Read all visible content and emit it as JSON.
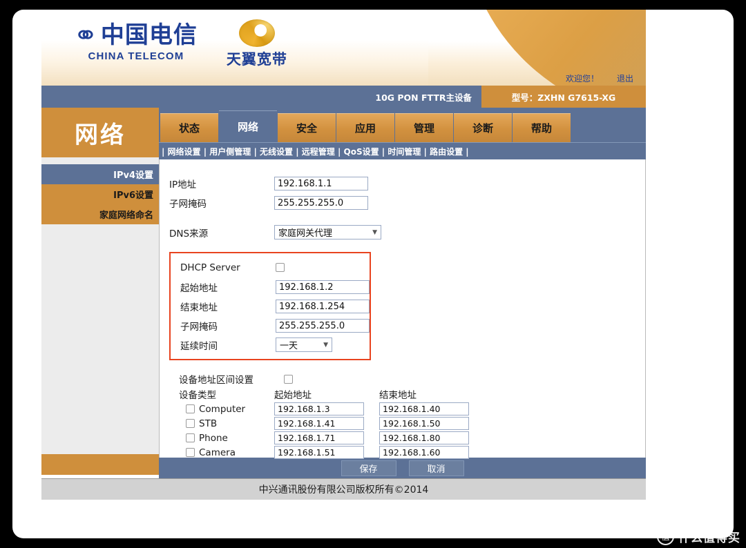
{
  "brand": {
    "telecom_cn": "中国电信",
    "telecom_en": "CHINA TELECOM",
    "broadband_cn": "天翼宽带"
  },
  "header": {
    "welcome": "欢迎您！",
    "logout": "退出",
    "device_type": "10G PON FTTR主设备",
    "model": "型号：ZXHN G7615-XG"
  },
  "sidebar": {
    "title": "网络",
    "items": [
      {
        "label": "IPv4设置",
        "active": true
      },
      {
        "label": "IPv6设置",
        "active": false
      },
      {
        "label": "家庭网络命名",
        "active": false
      }
    ]
  },
  "tabs": [
    {
      "label": "状态",
      "active": false
    },
    {
      "label": "网络",
      "active": true
    },
    {
      "label": "安全",
      "active": false
    },
    {
      "label": "应用",
      "active": false
    },
    {
      "label": "管理",
      "active": false
    },
    {
      "label": "诊断",
      "active": false
    },
    {
      "label": "帮助",
      "active": false
    }
  ],
  "subnav": "| 网络设置 | 用户侧管理 | 无线设置 | 远程管理 | QoS设置 | 时间管理 | 路由设置 |",
  "form": {
    "ip_label": "IP地址",
    "ip_value": "192.168.1.1",
    "mask_label": "子网掩码",
    "mask_value": "255.255.255.0",
    "dns_label": "DNS来源",
    "dns_value": "家庭网关代理"
  },
  "dhcp": {
    "title": "DHCP Server",
    "enabled": false,
    "start_label": "起始地址",
    "start_value": "192.168.1.2",
    "end_label": "结束地址",
    "end_value": "192.168.1.254",
    "mask_label": "子网掩码",
    "mask_value": "255.255.255.0",
    "lease_label": "延续时间",
    "lease_value": "一天",
    "highlight_color": "#e8431f"
  },
  "device_range": {
    "section_label": "设备地址区间设置",
    "enabled": false,
    "col_type": "设备类型",
    "col_start": "起始地址",
    "col_end": "结束地址",
    "rows": [
      {
        "name": "Computer",
        "checked": false,
        "start": "192.168.1.3",
        "end": "192.168.1.40"
      },
      {
        "name": "STB",
        "checked": false,
        "start": "192.168.1.41",
        "end": "192.168.1.50"
      },
      {
        "name": "Phone",
        "checked": false,
        "start": "192.168.1.71",
        "end": "192.168.1.80"
      },
      {
        "name": "Camera",
        "checked": false,
        "start": "192.168.1.51",
        "end": "192.168.1.60"
      }
    ]
  },
  "actions": {
    "save": "保存",
    "cancel": "取消"
  },
  "footer": {
    "copyright": "中兴通讯股份有限公司版权所有©2014"
  },
  "watermark": {
    "mark": "值",
    "text": "什么值得买"
  },
  "colors": {
    "orange": "#cf8f3c",
    "blue": "#5c7196",
    "accent_red": "#e8431f",
    "brand_blue": "#1f3f95"
  }
}
